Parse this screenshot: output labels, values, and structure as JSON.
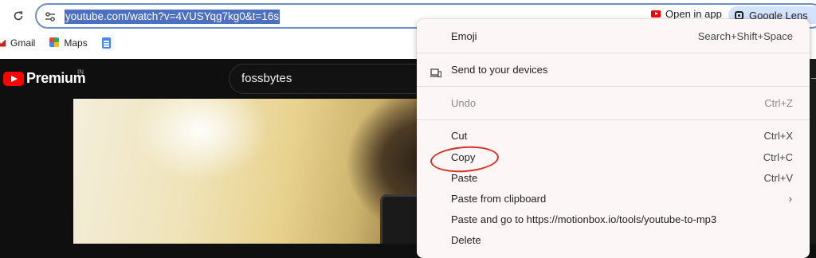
{
  "browser": {
    "url": "youtube.com/watch?v=4VUSYqg7kg0&t=16s",
    "open_in_app": "Open in app",
    "google_lens": "Google Lens",
    "bookmarks": [
      {
        "label": "Gmail",
        "icon": "gmail-icon"
      },
      {
        "label": "Maps",
        "icon": "maps-icon"
      },
      {
        "label": "",
        "icon": "google-docs-icon"
      }
    ]
  },
  "youtube": {
    "logo_text": "Premium",
    "country": "IN",
    "search_query": "fossbytes"
  },
  "context_menu": {
    "items": [
      {
        "label": "Emoji",
        "shortcut": "Search+Shift+Space",
        "icon": "",
        "disabled": false
      },
      {
        "label": "Send to your devices",
        "shortcut": "",
        "icon": "send-to-devices-icon",
        "disabled": false
      },
      {
        "label": "Undo",
        "shortcut": "Ctrl+Z",
        "icon": "",
        "disabled": true
      },
      {
        "label": "Cut",
        "shortcut": "Ctrl+X",
        "icon": "",
        "disabled": false
      },
      {
        "label": "Copy",
        "shortcut": "Ctrl+C",
        "icon": "",
        "disabled": false,
        "highlighted": true
      },
      {
        "label": "Paste",
        "shortcut": "Ctrl+V",
        "icon": "",
        "disabled": false
      },
      {
        "label": "Paste from clipboard",
        "shortcut": "",
        "icon": "",
        "submenu": true
      },
      {
        "label": "Paste and go to https://motionbox.io/tools/youtube-to-mp3",
        "shortcut": "",
        "icon": ""
      },
      {
        "label": "Delete",
        "shortcut": "",
        "icon": ""
      }
    ]
  },
  "colors": {
    "annotation": "#d93025",
    "url_selection": "#4c6fbf",
    "menu_background": "#fdf6f7"
  }
}
